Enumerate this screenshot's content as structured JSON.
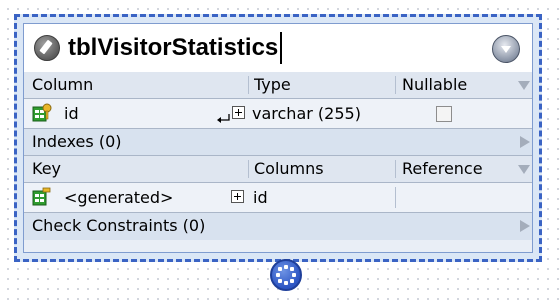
{
  "table": {
    "name": "tblVisitorStatistics",
    "columns_section": {
      "headers": [
        "Column",
        "Type",
        "Nullable"
      ],
      "rows": [
        {
          "name": "id",
          "type": "varchar (255)",
          "nullable": false
        }
      ]
    },
    "indexes_label": "Indexes (0)",
    "keys_section": {
      "headers": [
        "Key",
        "Columns",
        "Reference"
      ],
      "rows": [
        {
          "key": "<generated>",
          "columns": "id",
          "reference": ""
        }
      ]
    },
    "check_constraints_label": "Check Constraints (0)"
  },
  "icons": {
    "title": "edit-icon",
    "menu": "dropdown-menu-icon",
    "column_row": "primary-key-column-icon",
    "key_row": "primary-key-icon",
    "connector": "relationship-connector-icon"
  },
  "colors": {
    "border": "#3a63c4",
    "header_background": "#dfe6f0",
    "body_background": "#dbe7f6"
  }
}
